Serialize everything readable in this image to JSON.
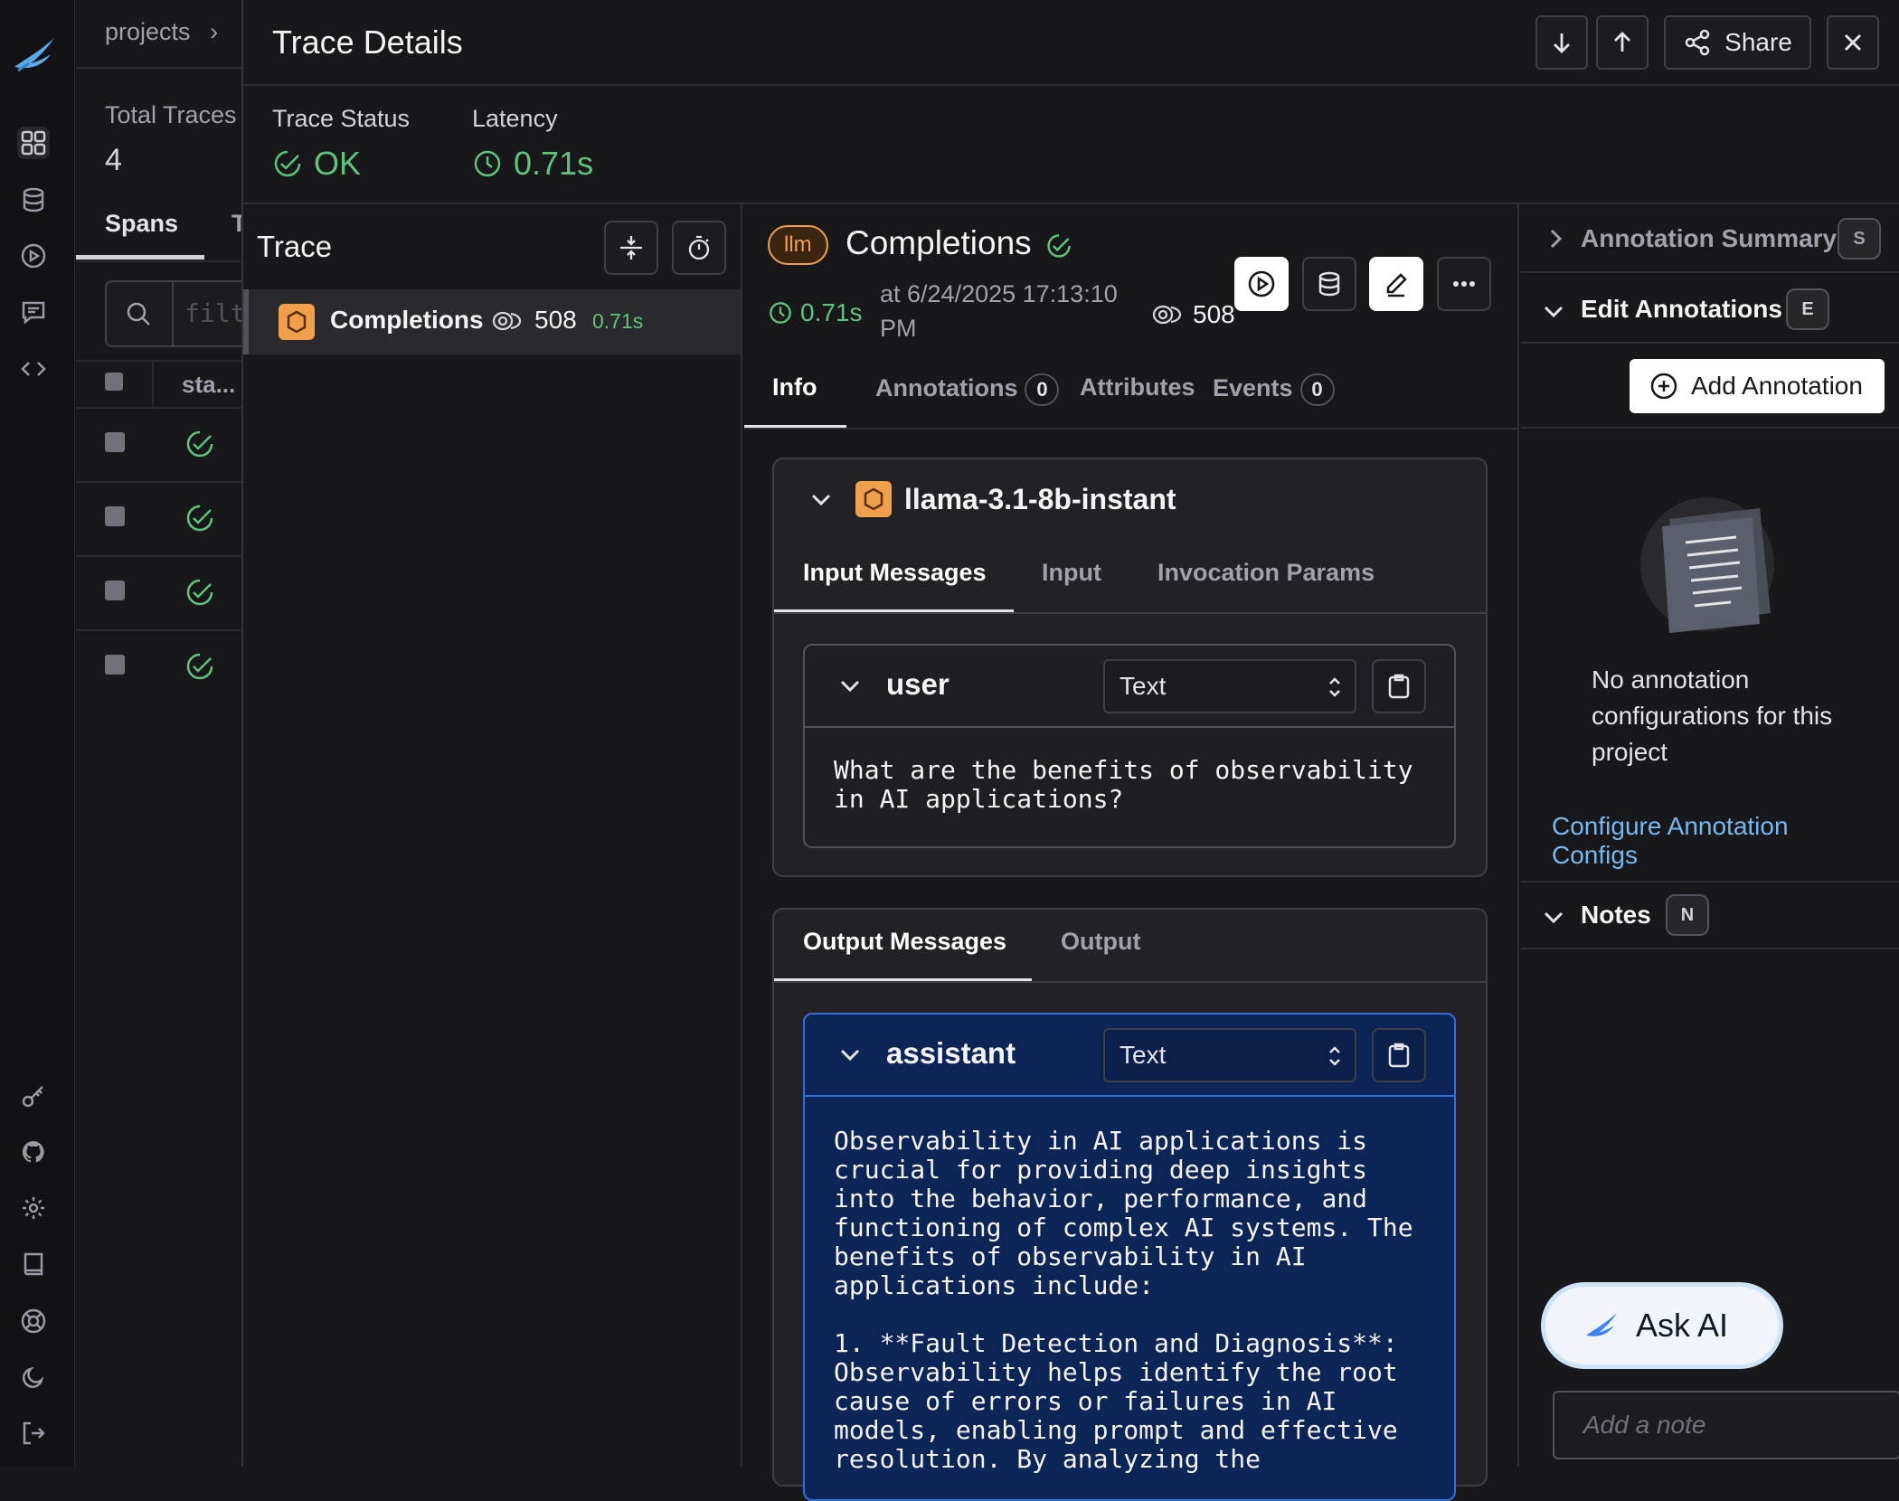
{
  "nav": {
    "icons": [
      "phoenix-logo-icon",
      "projects-icon",
      "datasets-icon",
      "playground-icon",
      "prompts-icon",
      "code-icon",
      "key-icon",
      "github-icon",
      "settings-icon",
      "docs-icon",
      "support-icon",
      "theme-icon",
      "logout-icon"
    ]
  },
  "background": {
    "breadcrumb": "projects",
    "total_traces_label": "Total Traces",
    "total_traces_value": "4",
    "tab_spans": "Spans",
    "tab_partial": "T",
    "filter_placeholder": "filt",
    "col_status": "sta..."
  },
  "drawer": {
    "title": "Trace Details",
    "share_label": "Share",
    "trace_status_label": "Trace Status",
    "trace_status_value": "OK",
    "latency_label": "Latency",
    "latency_value": "0.71s"
  },
  "trace_tree": {
    "title": "Trace",
    "span_name": "Completions",
    "span_tokens": "508",
    "span_latency": "0.71s"
  },
  "span": {
    "kind_badge": "llm",
    "name": "Completions",
    "latency": "0.71s",
    "timestamp": "at 6/24/2025 17:13:10 PM",
    "tokens": "508",
    "tabs": [
      {
        "label": "Info",
        "count": null
      },
      {
        "label": "Annotations",
        "count": "0"
      },
      {
        "label": "Attributes",
        "count": null
      },
      {
        "label": "Events",
        "count": "0"
      }
    ],
    "model_name": "llama-3.1-8b-instant",
    "input_tabs": [
      "Input Messages",
      "Input",
      "Invocation Params"
    ],
    "input_message": {
      "role": "user",
      "format": "Text",
      "content": "What are the benefits of observability\nin AI applications?"
    },
    "output_tabs": [
      "Output Messages",
      "Output"
    ],
    "output_message": {
      "role": "assistant",
      "format": "Text",
      "content": "Observability in AI applications is\ncrucial for providing deep insights\ninto the behavior, performance, and\nfunctioning of complex AI systems. The\nbenefits of observability in AI\napplications include:\n\n1. **Fault Detection and Diagnosis**:\nObservability helps identify the root\ncause of errors or failures in AI\nmodels, enabling prompt and effective\nresolution. By analyzing the"
    }
  },
  "annotations": {
    "summary_title": "Annotation Summary",
    "summary_key": "S",
    "edit_title": "Edit Annotations",
    "edit_key": "E",
    "add_button": "Add Annotation",
    "empty_text": "No annotation configurations for this project",
    "configure_link": "Configure Annotation Configs",
    "notes_title": "Notes",
    "notes_key": "N",
    "note_placeholder": "Add a note",
    "ask_ai": "Ask AI"
  },
  "colors": {
    "ok_green": "#5fc27e",
    "accent_blue": "#76b8f0",
    "llm_orange": "#f0a04b",
    "output_bg": "#0c2557",
    "output_border": "#2f6fd6"
  }
}
